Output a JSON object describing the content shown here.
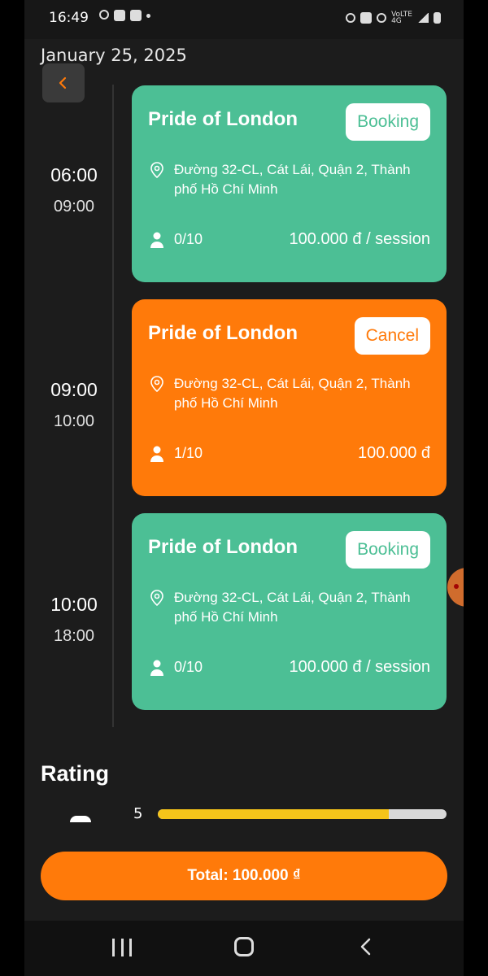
{
  "status_bar": {
    "time": "16:49",
    "icons": [
      "messenger-icon",
      "gallery-icon",
      "video-icon",
      "dot-icon",
      "alarm-icon",
      "mute-icon",
      "hotspot-icon",
      "data-icon",
      "signal-icon",
      "battery-icon"
    ]
  },
  "header": {
    "date": "January 25, 2025",
    "back_icon": "chevron-left-icon"
  },
  "sessions": [
    {
      "time_start": "06:00",
      "time_end": "09:00",
      "title": "Pride of London",
      "button": "Booking",
      "location": "Đường 32-CL, Cát Lái, Quận 2, Thành phố Hồ Chí Minh",
      "slots": "0/10",
      "price": "100.000 đ / session",
      "color": "#4cbf95"
    },
    {
      "time_start": "09:00",
      "time_end": "10:00",
      "title": "Pride of London",
      "button": "Cancel",
      "location": "Đường 32-CL, Cát Lái, Quận 2, Thành phố Hồ Chí Minh",
      "slots": "1/10",
      "price": "100.000 đ",
      "color": "#ff7a0a"
    },
    {
      "time_start": "10:00",
      "time_end": "18:00",
      "title": "Pride of London",
      "button": "Booking",
      "location": "Đường 32-CL, Cát Lái, Quận 2, Thành phố Hồ Chí Minh",
      "slots": "0/10",
      "price": "100.000 đ / session",
      "color": "#4cbf95"
    }
  ],
  "rating": {
    "title": "Rating",
    "rows": [
      {
        "star": "5",
        "fill_fraction": 0.8
      }
    ]
  },
  "footer": {
    "total_label": "Total: 100.000 ₫"
  },
  "colors": {
    "accent_green": "#4cbf95",
    "accent_orange": "#ff7a0a",
    "rating_yellow": "#f5c41a",
    "background": "#1c1c1c"
  }
}
